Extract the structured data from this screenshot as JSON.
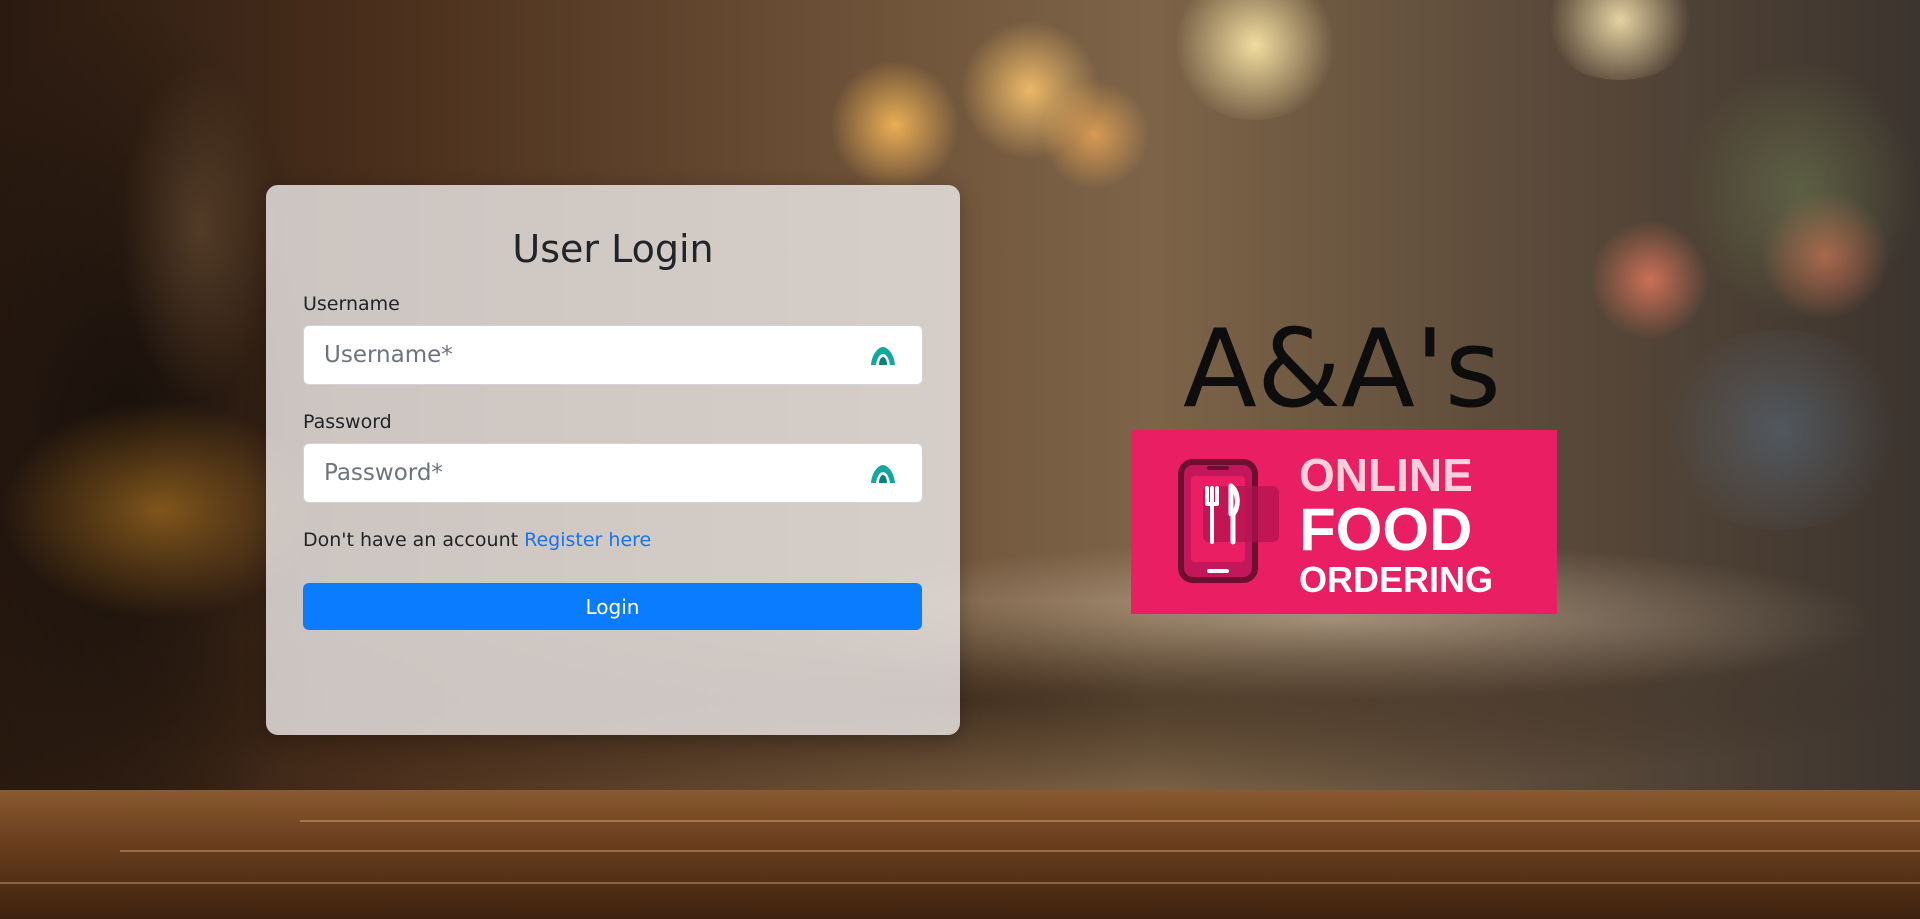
{
  "login_card": {
    "title": "User Login",
    "username_label": "Username",
    "username_placeholder": "Username*",
    "password_label": "Password",
    "password_placeholder": "Password*",
    "register_prompt": "Don't have an account",
    "register_link": "Register here",
    "login_button": "Login"
  },
  "brand": {
    "name": "A&A's",
    "logo_line1": "ONLINE",
    "logo_line2": "FOOD",
    "logo_line3": "ORDERING"
  },
  "colors": {
    "primary_button": "#0a7cff",
    "link": "#1a73e8",
    "logo_background": "#e91e63",
    "field_icon": "#13a89e"
  },
  "icons": {
    "username_field": "password-manager-icon",
    "password_field": "password-manager-icon",
    "logo": "phone-fork-knife-icon"
  }
}
